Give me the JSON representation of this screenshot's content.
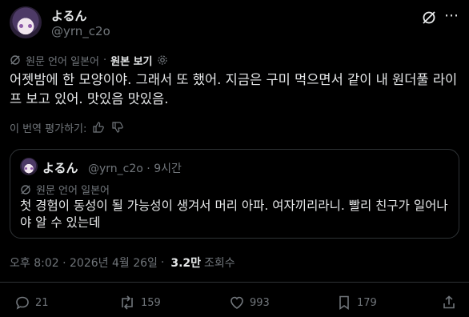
{
  "author": {
    "name": "よるん",
    "handle": "@yrn_c2o"
  },
  "translation": {
    "source_label": "원문 언어 일본어",
    "show_original": "원본 보기",
    "rate_label": "이 번역 평가하기:"
  },
  "tweet": {
    "text": "어젯밤에 한 모양이야. 그래서 또 했어. 지금은 구미 먹으면서 같이 내 원더풀 라이프 보고 있어. 맛있음 맛있음."
  },
  "quote": {
    "name": "よるん",
    "handle": "@yrn_c2o",
    "dot": "·",
    "time": "9시간",
    "source_label": "원문 언어 일본어",
    "text": "첫 경험이 동성이 될 가능성이 생겨서 머리 아파. 여자끼리라니. 빨리 친구가 일어나야 알 수 있는데"
  },
  "meta": {
    "timestamp": "오후 8:02 · 2026년 4월 26일",
    "dot": "·",
    "views_count": "3.2만",
    "views_label": "조회수"
  },
  "actions": {
    "replies": "21",
    "reposts": "159",
    "likes": "993",
    "bookmarks": "179"
  },
  "icons": [
    "grok-icon",
    "more-icon",
    "translate-icon",
    "gear-icon",
    "thumbs-up-icon",
    "thumbs-down-icon",
    "reply-icon",
    "repost-icon",
    "like-icon",
    "bookmark-icon",
    "share-icon"
  ],
  "colors": {
    "background": "#000000",
    "text": "#e7e9ea",
    "secondary": "#71767b",
    "border": "#2f3336"
  }
}
